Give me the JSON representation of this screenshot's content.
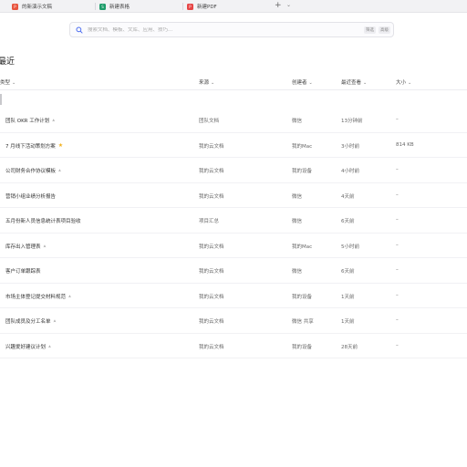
{
  "tabs": [
    {
      "label": "的新演示文稿",
      "badge": "P",
      "color": "#e8553e"
    },
    {
      "label": "新建表格",
      "badge": "S",
      "color": "#1f9d6b"
    },
    {
      "label": "新建PDF",
      "badge": "P",
      "color": "#e64545"
    }
  ],
  "tabbar": {
    "add": "+",
    "menu": "⌄"
  },
  "search": {
    "placeholder": "搜索文档、模板、文库、应用、技巧...",
    "kbd1": "筛选",
    "kbd2": "高级"
  },
  "page": {
    "title": "最近"
  },
  "columns": {
    "type": "类型",
    "source": "来源",
    "creator": "创建者",
    "recent": "最近查看",
    "size": "大小",
    "caret": "⌄"
  },
  "rows": [
    {
      "name": "团队 OKR 工作计划",
      "share": true,
      "star": false,
      "source": "团队文档",
      "creator": "微信",
      "recent": "13分钟前",
      "size": "–"
    },
    {
      "name": "7 月线下活动策划方案",
      "share": false,
      "star": true,
      "source": "我的云文档",
      "creator": "我的Mac",
      "recent": "3小时前",
      "size": "814 KB"
    },
    {
      "name": "公司财务合作协议模板",
      "share": true,
      "star": false,
      "source": "我的云文档",
      "creator": "我的设备",
      "recent": "4小时前",
      "size": "–"
    },
    {
      "name": "营销小组业绩分析报告",
      "share": false,
      "star": false,
      "source": "我的云文档",
      "creator": "微信",
      "recent": "4天前",
      "size": "–"
    },
    {
      "name": "五月份新人员信息统计表项目验收",
      "share": false,
      "star": false,
      "source": "项目汇总",
      "creator": "微信",
      "recent": "6天前",
      "size": "–"
    },
    {
      "name": "库存出入管理表",
      "share": true,
      "star": false,
      "source": "我的云文档",
      "creator": "我的Mac",
      "recent": "5小时前",
      "size": "–"
    },
    {
      "name": "客户订单跟踪表",
      "share": false,
      "star": false,
      "source": "我的云文档",
      "creator": "微信",
      "recent": "6天前",
      "size": "–"
    },
    {
      "name": "市场主体登记提交材料规范",
      "share": true,
      "star": false,
      "source": "我的云文档",
      "creator": "我的设备",
      "recent": "1天前",
      "size": "–"
    },
    {
      "name": "团队成员及分工名单",
      "share": true,
      "star": false,
      "source": "我的云文档",
      "creator": "微信 共享",
      "recent": "1天前",
      "size": "–"
    },
    {
      "name": "兴趣爱好建议计划",
      "share": true,
      "star": false,
      "source": "我的云文档",
      "creator": "我的设备",
      "recent": "28天前",
      "size": "–"
    }
  ],
  "icons": {
    "share": "⩓",
    "star": "★"
  }
}
